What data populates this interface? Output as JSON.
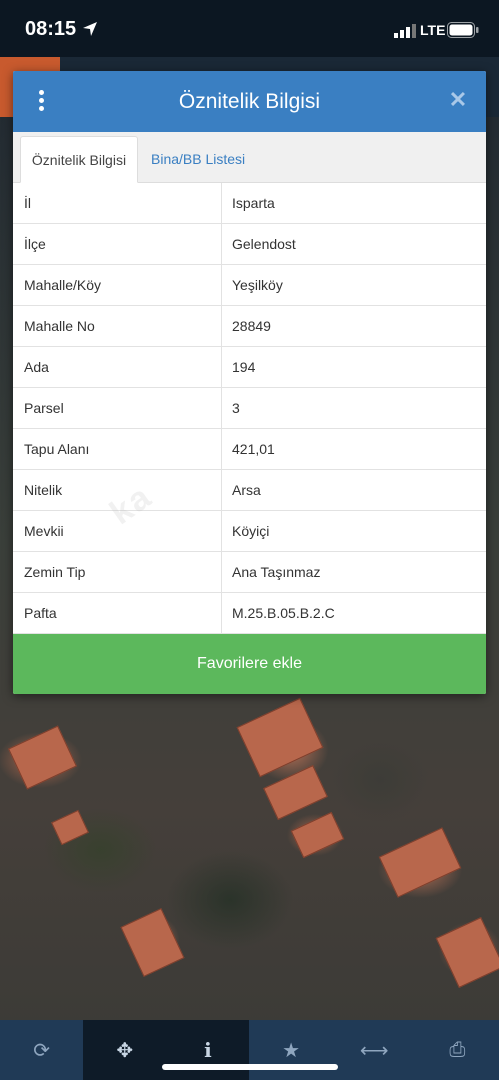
{
  "status_bar": {
    "time": "08:15",
    "network": "LTE"
  },
  "dialog": {
    "title": "Öznitelik Bilgisi",
    "tabs": [
      {
        "label": "Öznitelik Bilgisi",
        "active": true
      },
      {
        "label": "Bina/BB Listesi",
        "active": false
      }
    ],
    "rows": [
      {
        "key": "İl",
        "value": "Isparta"
      },
      {
        "key": "İlçe",
        "value": "Gelendost"
      },
      {
        "key": "Mahalle/Köy",
        "value": "Yeşilköy"
      },
      {
        "key": "Mahalle No",
        "value": "28849"
      },
      {
        "key": "Ada",
        "value": "194"
      },
      {
        "key": "Parsel",
        "value": "3"
      },
      {
        "key": "Tapu Alanı",
        "value": "421,01"
      },
      {
        "key": "Nitelik",
        "value": "Arsa"
      },
      {
        "key": "Mevkii",
        "value": "Köyiçi"
      },
      {
        "key": "Zemin Tip",
        "value": "Ana Taşınmaz"
      },
      {
        "key": "Pafta",
        "value": "M.25.B.05.B.2.C"
      }
    ],
    "favorite_button": "Favorilere ekle",
    "watermark": "ka"
  },
  "toolbar": {
    "items": [
      {
        "icon": "refresh-icon",
        "glyph": "⟳",
        "active": false
      },
      {
        "icon": "locate-icon",
        "glyph": "✥",
        "active": true
      },
      {
        "icon": "info-icon",
        "glyph": "i",
        "active": true
      },
      {
        "icon": "star-icon",
        "glyph": "★",
        "active": false
      },
      {
        "icon": "measure-icon",
        "glyph": "⟷",
        "active": false
      },
      {
        "icon": "print-icon",
        "glyph": "⎙",
        "active": false
      }
    ]
  },
  "colors": {
    "header_blue": "#3a7fc2",
    "button_green": "#5cb85c",
    "toolbar_bg": "#203a56"
  }
}
